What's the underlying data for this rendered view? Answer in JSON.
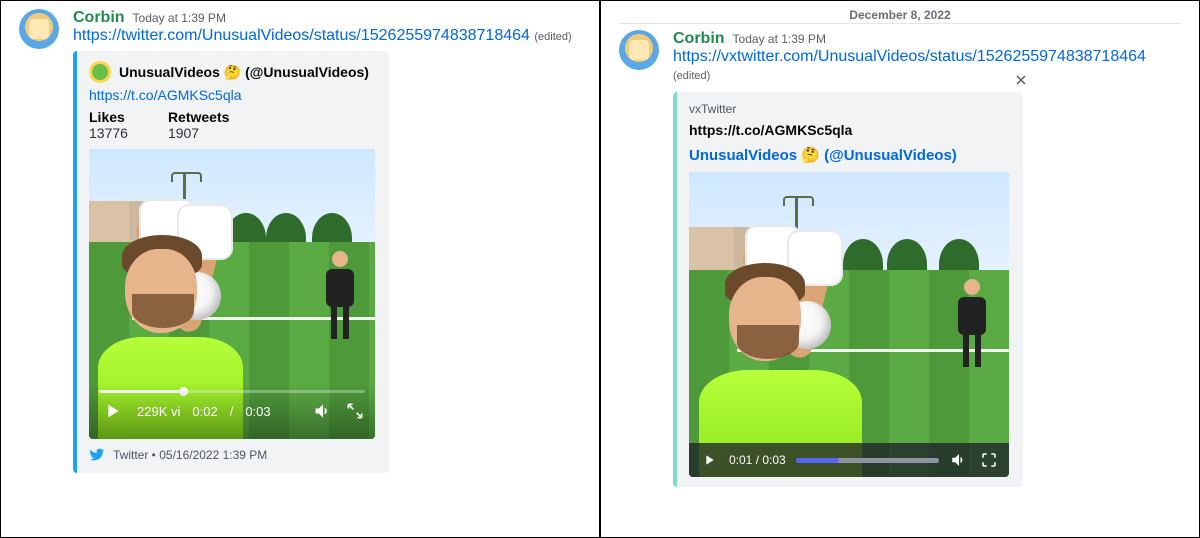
{
  "left": {
    "author": "Corbin",
    "timestamp": "Today at 1:39 PM",
    "link": "https://twitter.com/UnusualVideos/status/1526255974838718464",
    "edited": "(edited)",
    "embed": {
      "author_name": "UnusualVideos 🤔 (@UnusualVideos)",
      "desc_link": "https://t.co/AGMKSc5qla",
      "fields": {
        "likes_label": "Likes",
        "likes_value": "13776",
        "retweets_label": "Retweets",
        "retweets_value": "1907"
      },
      "video": {
        "views": "229K vi",
        "time_current": "0:02",
        "time_sep": " / ",
        "time_total": "0:03"
      },
      "footer": {
        "provider": "Twitter",
        "sep": " • ",
        "date": "05/16/2022 1:39 PM"
      }
    }
  },
  "right": {
    "date_divider": "December 8, 2022",
    "author": "Corbin",
    "timestamp": "Today at 1:39 PM",
    "link": "https://vxtwitter.com/UnusualVideos/status/1526255974838718464",
    "edited": "(edited)",
    "embed": {
      "provider": "vxTwitter",
      "desc_bold": "https://t.co/AGMKSc5qla",
      "title": "UnusualVideos 🤔 (@UnusualVideos)",
      "video": {
        "time_current": "0:01",
        "time_sep": " / ",
        "time_total": "0:03"
      }
    }
  }
}
